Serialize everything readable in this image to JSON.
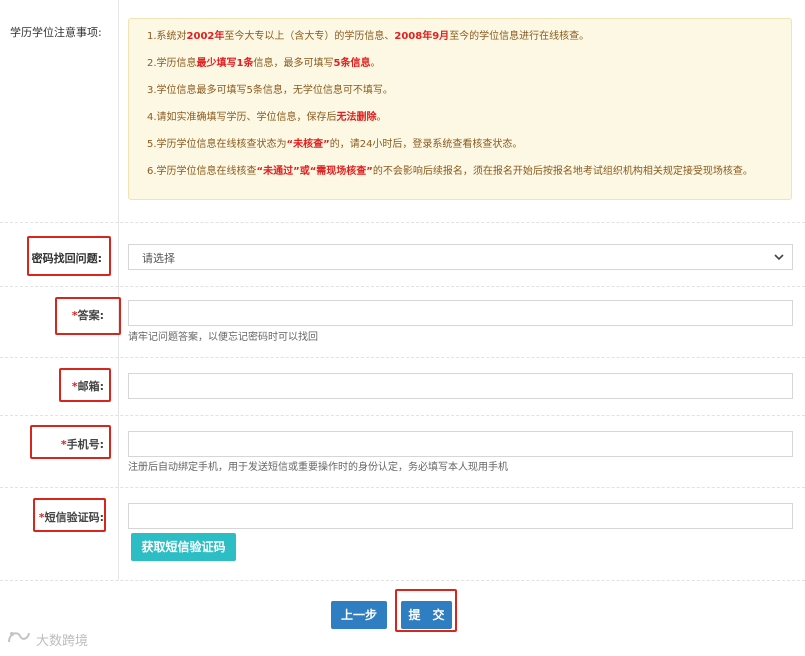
{
  "notice": {
    "label": "学历学位注意事项:",
    "lines": [
      [
        {
          "t": "1.系统对"
        },
        {
          "t": "2002年",
          "hl": true
        },
        {
          "t": "至今大专以上（含大专）的学历信息、"
        },
        {
          "t": "2008年9月",
          "hl": true
        },
        {
          "t": "至今的学位信息进行在线核查。"
        }
      ],
      [
        {
          "t": "2.学历信息"
        },
        {
          "t": "最少填写1条",
          "hl": true
        },
        {
          "t": "信息，最多可填写"
        },
        {
          "t": "5条信息",
          "hl": true
        },
        {
          "t": "。"
        }
      ],
      [
        {
          "t": "3.学位信息最多可填写5条信息，无学位信息可不填写。"
        }
      ],
      [
        {
          "t": "4.请如实准确填写学历、学位信息，保存后"
        },
        {
          "t": "无法删除",
          "hl": true
        },
        {
          "t": "。"
        }
      ],
      [
        {
          "t": "5.学历学位信息在线核查状态为"
        },
        {
          "t": "“未核查”",
          "hl": true
        },
        {
          "t": "的，请24小时后，登录系统查看核查状态。"
        }
      ],
      [
        {
          "t": "6.学历学位信息在线核查"
        },
        {
          "t": "“未通过”或“需现场核查”",
          "hl": true
        },
        {
          "t": "的不会影响后续报名，须在报名开始后按报名地考试组织机构相关规定接受现场核查。"
        }
      ]
    ]
  },
  "form": {
    "security_question": {
      "label": "密码找回问题:",
      "selected": "请选择"
    },
    "answer": {
      "required_mark": "*",
      "label": "答案:",
      "value": "",
      "hint": "请牢记问题答案，以便忘记密码时可以找回"
    },
    "email": {
      "required_mark": "*",
      "label": "邮箱:",
      "value": ""
    },
    "phone": {
      "required_mark": "*",
      "label": "手机号:",
      "value": "",
      "hint": "注册后自动绑定手机，用于发送短信或重要操作时的身份认定，务必填写本人现用手机"
    },
    "sms_code": {
      "required_mark": "*",
      "label": "短信验证码:",
      "value": "",
      "get_code_label": "获取短信验证码"
    }
  },
  "buttons": {
    "prev_label": "上一步",
    "submit_label": "提　交"
  },
  "watermark": {
    "text": "大数跨境"
  },
  "colors": {
    "primary": "#2e7ec1",
    "teal": "#2dbdc4",
    "highlight_red": "#e02020",
    "notice_bg": "#fcf8e3",
    "annotation_box": "#d9261c"
  }
}
